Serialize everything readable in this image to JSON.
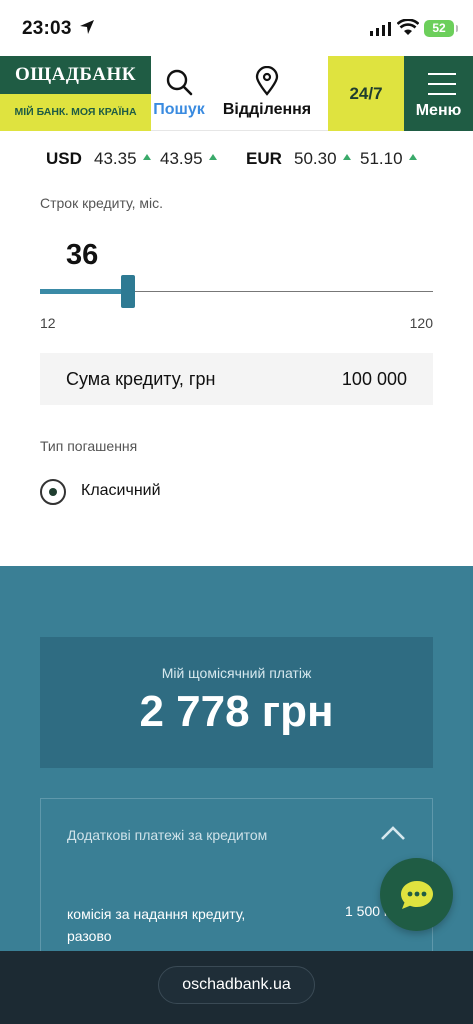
{
  "status_bar": {
    "time": "23:03",
    "battery": "52"
  },
  "header": {
    "logo_name": "ОЩАДБАНК",
    "logo_slogan": "МІЙ БАНК. МОЯ КРАЇНА",
    "search_label": "Пошук",
    "branches_label": "Відділення",
    "support_label": "24/7",
    "menu_label": "Меню"
  },
  "rates": {
    "usd": {
      "code": "USD",
      "buy": "43.35",
      "sell": "43.95"
    },
    "eur": {
      "code": "EUR",
      "buy": "50.30",
      "sell": "51.10"
    }
  },
  "form": {
    "term_label": "Строк кредиту, міс.",
    "term_value": "36",
    "term_min": "12",
    "term_max": "120",
    "amount_label": "Сума кредиту, грн",
    "amount_value": "100 000",
    "repayment_label": "Тип погашення",
    "repayment_option": "Класичний"
  },
  "results": {
    "monthly_label": "Мій щомісячний платіж",
    "monthly_value": "2 778 грн",
    "extra_title": "Додаткові платежі за кредитом",
    "extra_row_label": "комісія за надання кредиту, разово",
    "extra_row_value": "1 500 г"
  },
  "browser": {
    "url": "oschadbank.ua"
  },
  "colors": {
    "brand_green": "#1f5c44",
    "brand_yellow": "#dfe33f",
    "teal": "#3a7f95",
    "link_blue": "#3a8be0"
  }
}
